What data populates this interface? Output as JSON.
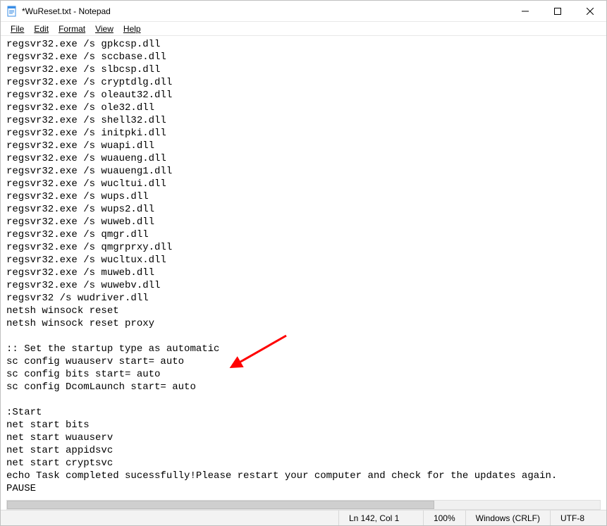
{
  "window": {
    "title": "*WuReset.txt - Notepad"
  },
  "menu": {
    "file": "File",
    "edit": "Edit",
    "format": "Format",
    "view": "View",
    "help": "Help"
  },
  "content": "regsvr32.exe /s gpkcsp.dll\nregsvr32.exe /s sccbase.dll\nregsvr32.exe /s slbcsp.dll\nregsvr32.exe /s cryptdlg.dll\nregsvr32.exe /s oleaut32.dll\nregsvr32.exe /s ole32.dll\nregsvr32.exe /s shell32.dll\nregsvr32.exe /s initpki.dll\nregsvr32.exe /s wuapi.dll\nregsvr32.exe /s wuaueng.dll\nregsvr32.exe /s wuaueng1.dll\nregsvr32.exe /s wucltui.dll\nregsvr32.exe /s wups.dll\nregsvr32.exe /s wups2.dll\nregsvr32.exe /s wuweb.dll\nregsvr32.exe /s qmgr.dll\nregsvr32.exe /s qmgrprxy.dll\nregsvr32.exe /s wucltux.dll\nregsvr32.exe /s muweb.dll\nregsvr32.exe /s wuwebv.dll\nregsvr32 /s wudriver.dll\nnetsh winsock reset\nnetsh winsock reset proxy\n\n:: Set the startup type as automatic\nsc config wuauserv start= auto\nsc config bits start= auto\nsc config DcomLaunch start= auto\n\n:Start\nnet start bits\nnet start wuauserv\nnet start appidsvc\nnet start cryptsvc\necho Task completed sucessfully!Please restart your computer and check for the updates again.\nPAUSE",
  "status": {
    "position": "Ln 142, Col 1",
    "zoom": "100%",
    "eol": "Windows (CRLF)",
    "encoding": "UTF-8"
  },
  "annotation": {
    "arrow_color": "#ff0000"
  }
}
